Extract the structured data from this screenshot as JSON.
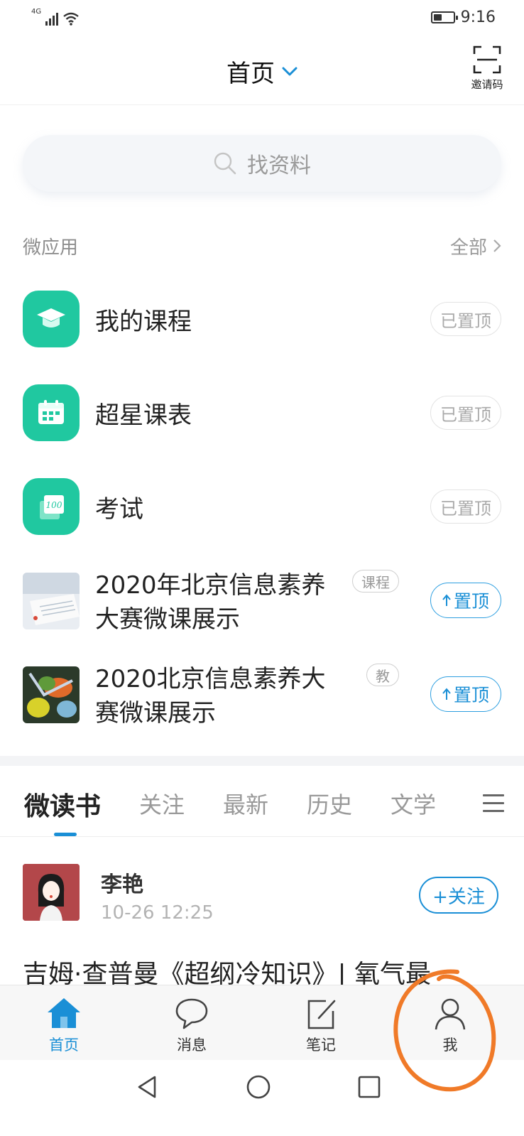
{
  "status_bar": {
    "network": "4G",
    "time": "9:16",
    "battery_level": 0.45
  },
  "header": {
    "title": "首页",
    "invite_label": "邀请码"
  },
  "search": {
    "placeholder": "找资料"
  },
  "micro_apps": {
    "title": "微应用",
    "all_label": "全部",
    "pinned_apps": [
      {
        "label": "我的课程",
        "badge": "已置顶",
        "icon": "graduation-cap-icon"
      },
      {
        "label": "超星课表",
        "badge": "已置顶",
        "icon": "calendar-icon"
      },
      {
        "label": "考试",
        "badge": "已置顶",
        "icon": "exam-100-icon"
      }
    ],
    "courses": [
      {
        "title_line1": "2020年北京信息素养",
        "title_line2": "大赛微课展示",
        "tag": "课程",
        "pin_label": "置顶"
      },
      {
        "title_line1": "2020北京信息素养大",
        "title_line2": "赛微课展示",
        "tag": "教",
        "pin_label": "置顶"
      }
    ]
  },
  "reading": {
    "tabs": [
      "微读书",
      "关注",
      "最新",
      "历史",
      "文学"
    ],
    "active_tab": "微读书"
  },
  "feed_item": {
    "author": "李艳",
    "time": "10-26 12:25",
    "follow_label": "+关注",
    "title": "吉姆·查普曼《超纲冷知识》| 氧气最"
  },
  "tabbar": {
    "items": [
      {
        "label": "首页",
        "icon": "home-icon",
        "active": true
      },
      {
        "label": "消息",
        "icon": "chat-bubble-icon",
        "active": false
      },
      {
        "label": "笔记",
        "icon": "note-edit-icon",
        "active": false
      },
      {
        "label": "我",
        "icon": "person-icon",
        "active": false
      }
    ]
  },
  "colors": {
    "accent": "#1a8fd6",
    "app_green": "#20c8a0",
    "annotation": "#f07a28"
  }
}
